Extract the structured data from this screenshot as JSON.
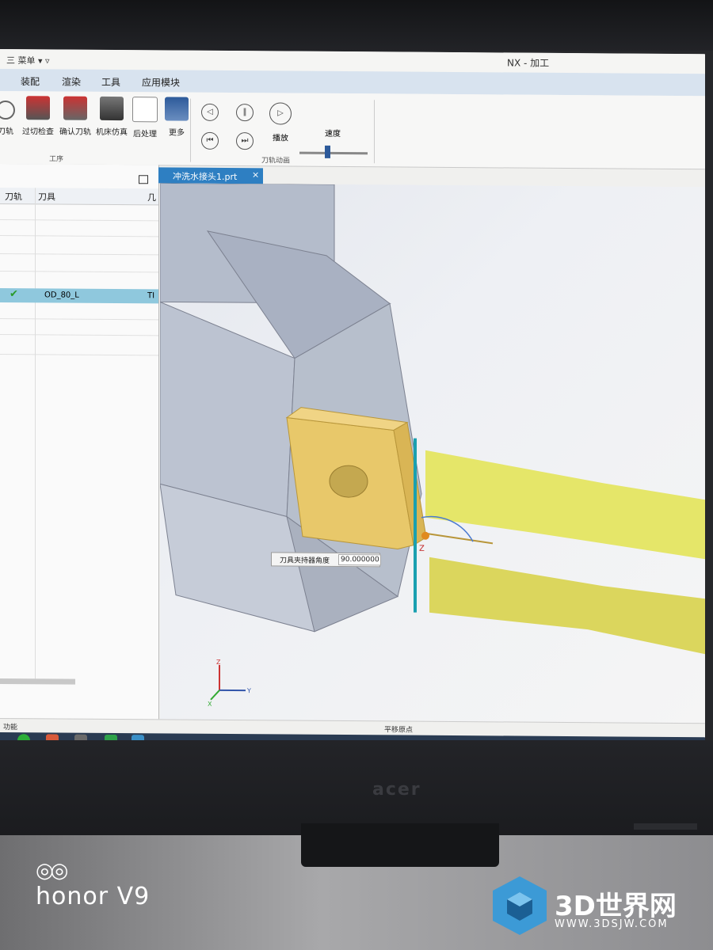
{
  "window": {
    "menu_label": "三 菜单 ▾ ▿",
    "title": "NX - 加工"
  },
  "ribbon_tabs": [
    "装配",
    "渲染",
    "工具",
    "应用模块"
  ],
  "ribbon": {
    "buttons": [
      "刀轨",
      "过切检查",
      "确认刀轨",
      "机床仿真",
      "后处理",
      "更多"
    ],
    "group_operation": "工序",
    "play_label": "播放",
    "speed_label": "速度",
    "group_animation": "刀轨动画"
  },
  "navigator": {
    "columns": [
      "刀轨",
      "刀具",
      "几"
    ],
    "selected_row": {
      "tool": "OD_80_L",
      "extra": "TI"
    }
  },
  "document_tab": {
    "label": "冲洗水接头1.prt",
    "close": "×"
  },
  "viewport": {
    "tooltip_label": "刀具夹持器角度",
    "tooltip_value": "90.000000",
    "axes": {
      "x": "X",
      "y": "Y",
      "z": "Z"
    }
  },
  "statusbar": {
    "left": "功能",
    "center": "平移原点"
  },
  "monitor": {
    "brand": "acer"
  },
  "watermark": {
    "phone": "honor V9",
    "rings": "◎◎",
    "site": "3D世界网",
    "site_url": "WWW.3DSJW.COM"
  },
  "colors": {
    "ribbon_tab_bg": "#d8e3ef",
    "selection": "#8fc8dd",
    "doc_tab": "#2e7fc2",
    "tool_insert": "#e8c86a",
    "toolpath_yellow": "#e6e85a"
  }
}
